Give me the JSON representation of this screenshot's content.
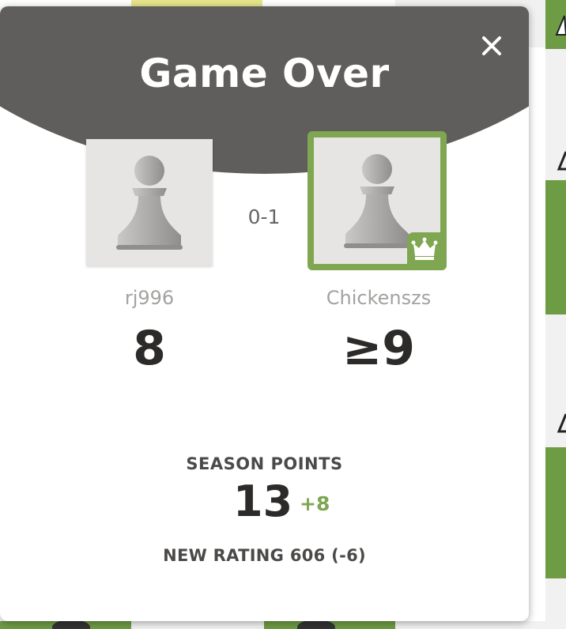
{
  "modal": {
    "title": "Game Over",
    "result": "0-1"
  },
  "players": {
    "left": {
      "name": "rj996",
      "rating": "8"
    },
    "right": {
      "name": "Chickenszs",
      "rating": "≥9",
      "winner": true
    }
  },
  "season": {
    "label": "SEASON POINTS",
    "points": "13",
    "delta": "+8"
  },
  "new_rating": "NEW RATING 606 (-6)",
  "colors": {
    "header": "#5f5e5c",
    "accent": "#7fa651",
    "board_dark": "#6e9c44",
    "board_light": "#eeeed2"
  },
  "icons": [
    "close-icon",
    "pawn-icon",
    "crown-icon"
  ]
}
